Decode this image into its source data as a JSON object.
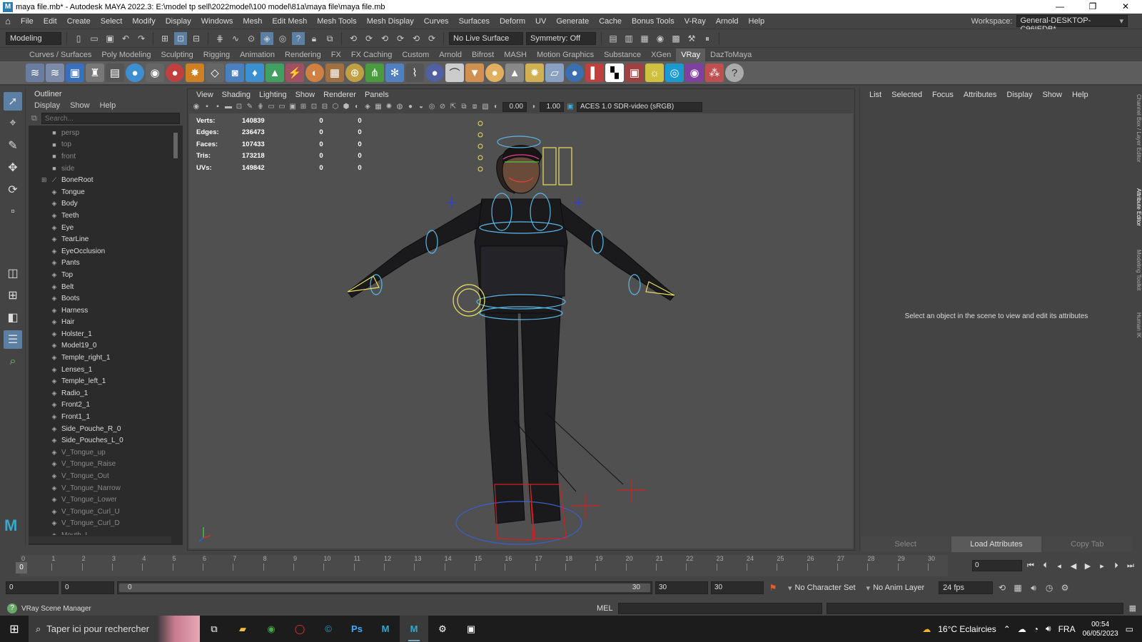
{
  "titlebar": {
    "title": "maya file.mb* - Autodesk MAYA 2022.3: E:\\model tp sell\\2022model\\100 model\\81a\\maya file\\maya file.mb",
    "minimize": "—",
    "restore": "❐",
    "close": "✕"
  },
  "menubar": {
    "items": [
      "File",
      "Edit",
      "Create",
      "Select",
      "Modify",
      "Display",
      "Windows",
      "Mesh",
      "Edit Mesh",
      "Mesh Tools",
      "Mesh Display",
      "Curves",
      "Surfaces",
      "Deform",
      "UV",
      "Generate",
      "Cache",
      "Bonus Tools",
      "V-Ray",
      "Arnold",
      "Help"
    ],
    "workspace_label": "Workspace:",
    "workspace_value": "General-DESKTOP-C96IEDB*"
  },
  "statusline": {
    "menuset": "Modeling",
    "live_surface": "No Live Surface",
    "symmetry": "Symmetry: Off"
  },
  "shelf": {
    "tabs": [
      "Curves / Surfaces",
      "Poly Modeling",
      "Sculpting",
      "Rigging",
      "Animation",
      "Rendering",
      "FX",
      "FX Caching",
      "Custom",
      "Arnold",
      "Bifrost",
      "MASH",
      "Motion Graphics",
      "Substance",
      "XGen",
      "VRay",
      "DazToMaya"
    ],
    "active_tab": "VRay"
  },
  "outliner": {
    "title": "Outliner",
    "menu": [
      "Display",
      "Show",
      "Help"
    ],
    "search_placeholder": "Search...",
    "items": [
      {
        "label": "persp",
        "icon": "camera-icon",
        "dim": true
      },
      {
        "label": "top",
        "icon": "camera-icon",
        "dim": true
      },
      {
        "label": "front",
        "icon": "camera-icon",
        "dim": true
      },
      {
        "label": "side",
        "icon": "camera-icon",
        "dim": true
      },
      {
        "label": "BoneRoot",
        "icon": "joint-icon",
        "dim": false,
        "expandable": true
      },
      {
        "label": "Tongue",
        "icon": "transform-icon",
        "dim": false
      },
      {
        "label": "Body",
        "icon": "transform-icon",
        "dim": false
      },
      {
        "label": "Teeth",
        "icon": "transform-icon",
        "dim": false
      },
      {
        "label": "Eye",
        "icon": "transform-icon",
        "dim": false
      },
      {
        "label": "TearLine",
        "icon": "transform-icon",
        "dim": false
      },
      {
        "label": "EyeOcclusion",
        "icon": "transform-icon",
        "dim": false
      },
      {
        "label": "Pants",
        "icon": "transform-icon",
        "dim": false
      },
      {
        "label": "Top",
        "icon": "transform-icon",
        "dim": false
      },
      {
        "label": "Belt",
        "icon": "transform-icon",
        "dim": false
      },
      {
        "label": "Boots",
        "icon": "transform-icon",
        "dim": false
      },
      {
        "label": "Harness",
        "icon": "transform-icon",
        "dim": false
      },
      {
        "label": "Hair",
        "icon": "transform-icon",
        "dim": false
      },
      {
        "label": "Holster_1",
        "icon": "transform-icon",
        "dim": false
      },
      {
        "label": "Model19_0",
        "icon": "transform-icon",
        "dim": false
      },
      {
        "label": "Temple_right_1",
        "icon": "transform-icon",
        "dim": false
      },
      {
        "label": "Lenses_1",
        "icon": "transform-icon",
        "dim": false
      },
      {
        "label": "Temple_left_1",
        "icon": "transform-icon",
        "dim": false
      },
      {
        "label": "Radio_1",
        "icon": "transform-icon",
        "dim": false
      },
      {
        "label": "Front2_1",
        "icon": "transform-icon",
        "dim": false
      },
      {
        "label": "Front1_1",
        "icon": "transform-icon",
        "dim": false
      },
      {
        "label": "Side_Pouche_R_0",
        "icon": "transform-icon",
        "dim": false
      },
      {
        "label": "Side_Pouches_L_0",
        "icon": "transform-icon",
        "dim": false
      },
      {
        "label": "V_Tongue_up",
        "icon": "transform-icon",
        "dim": true
      },
      {
        "label": "V_Tongue_Raise",
        "icon": "transform-icon",
        "dim": true
      },
      {
        "label": "V_Tongue_Out",
        "icon": "transform-icon",
        "dim": true
      },
      {
        "label": "V_Tongue_Narrow",
        "icon": "transform-icon",
        "dim": true
      },
      {
        "label": "V_Tongue_Lower",
        "icon": "transform-icon",
        "dim": true
      },
      {
        "label": "V_Tongue_Curl_U",
        "icon": "transform-icon",
        "dim": true
      },
      {
        "label": "V_Tongue_Curl_D",
        "icon": "transform-icon",
        "dim": true
      },
      {
        "label": "Mouth_I",
        "icon": "transform-icon",
        "dim": true
      }
    ]
  },
  "viewport": {
    "menu": [
      "View",
      "Shading",
      "Lighting",
      "Show",
      "Renderer",
      "Panels"
    ],
    "exposure": "0.00",
    "gamma": "1.00",
    "color_space": "ACES 1.0 SDR-video (sRGB)",
    "hud": [
      {
        "label": "Verts:",
        "total": "140839",
        "sel": "0",
        "comp": "0"
      },
      {
        "label": "Edges:",
        "total": "236473",
        "sel": "0",
        "comp": "0"
      },
      {
        "label": "Faces:",
        "total": "107433",
        "sel": "0",
        "comp": "0"
      },
      {
        "label": "Tris:",
        "total": "173218",
        "sel": "0",
        "comp": "0"
      },
      {
        "label": "UVs:",
        "total": "149842",
        "sel": "0",
        "comp": "0"
      }
    ]
  },
  "attribute_editor": {
    "menu": [
      "List",
      "Selected",
      "Focus",
      "Attributes",
      "Display",
      "Show",
      "Help"
    ],
    "message": "Select an object in the scene to view and edit its attributes",
    "buttons": [
      "Select",
      "Load Attributes",
      "Copy Tab"
    ],
    "side_tabs": [
      "Channel Box / Layer Editor",
      "Attribute Editor",
      "Modeling Toolkit",
      "Human IK"
    ]
  },
  "timeslider": {
    "ticks": [
      "0",
      "1",
      "2",
      "3",
      "4",
      "5",
      "6",
      "7",
      "8",
      "9",
      "10",
      "11",
      "12",
      "13",
      "14",
      "15",
      "16",
      "17",
      "18",
      "19",
      "20",
      "21",
      "22",
      "23",
      "24",
      "25",
      "26",
      "27",
      "28",
      "29",
      "30"
    ],
    "current_frame": "0",
    "current_frame_field": "0"
  },
  "rangeslider": {
    "start": "0",
    "anim_start": "0",
    "range_left": "0",
    "range_right": "30",
    "end": "30",
    "anim_end": "30",
    "character_set": "No Character Set",
    "anim_layer": "No Anim Layer",
    "fps": "24 fps"
  },
  "commandline": {
    "help_text": "VRay Scene Manager",
    "language": "MEL"
  },
  "taskbar": {
    "search_text": "Taper ici pour rechercher",
    "weather": "16°C  Eclaircies",
    "language": "FRA",
    "time": "00:54",
    "date": "06/05/2023"
  },
  "colors": {
    "accent": "#5c7fa4",
    "panel": "#444444",
    "field": "#2b2b2b",
    "viewport": "#505050"
  }
}
